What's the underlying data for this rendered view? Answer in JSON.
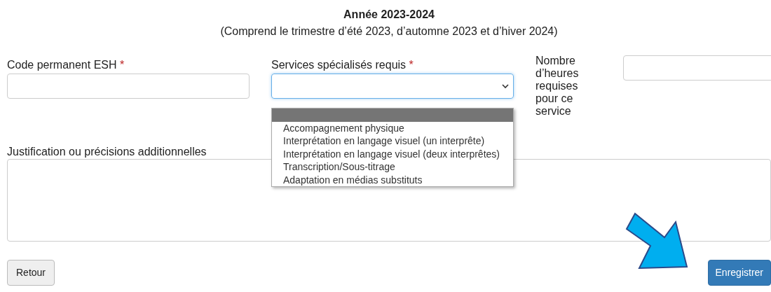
{
  "heading": {
    "title": "Année 2023-2024",
    "subtitle": "(Comprend le trimestre d’été 2023, d’automne 2023 et d’hiver 2024)"
  },
  "fields": [
    {
      "kind": "text",
      "label": "Code permanent ESH",
      "required_mark": "*"
    },
    {
      "kind": "select",
      "label": "Services spécialisés requis",
      "required_mark": "*",
      "expanded": true,
      "options": [
        {
          "selected": true
        },
        {
          "label": "Accompagnement physique",
          "selected": false
        },
        {
          "label": "Interprétation en langage visuel (un interprête)",
          "selected": false
        },
        {
          "label": "Interprétation en langage visuel (deux interprêtes)",
          "selected": false
        },
        {
          "label": "Transcription/Sous-titrage",
          "selected": false
        },
        {
          "label": "Adaptation en médias substituts",
          "selected": false
        }
      ]
    },
    {
      "kind": "text",
      "label": "Nombre d’heures requises pour ce service"
    }
  ],
  "textarea": {
    "label": "Justification ou précisions additionnelles"
  },
  "buttons": [
    {
      "kind": "secondary",
      "label": "Retour"
    },
    {
      "kind": "primary",
      "label": "Enregistrer"
    }
  ]
}
